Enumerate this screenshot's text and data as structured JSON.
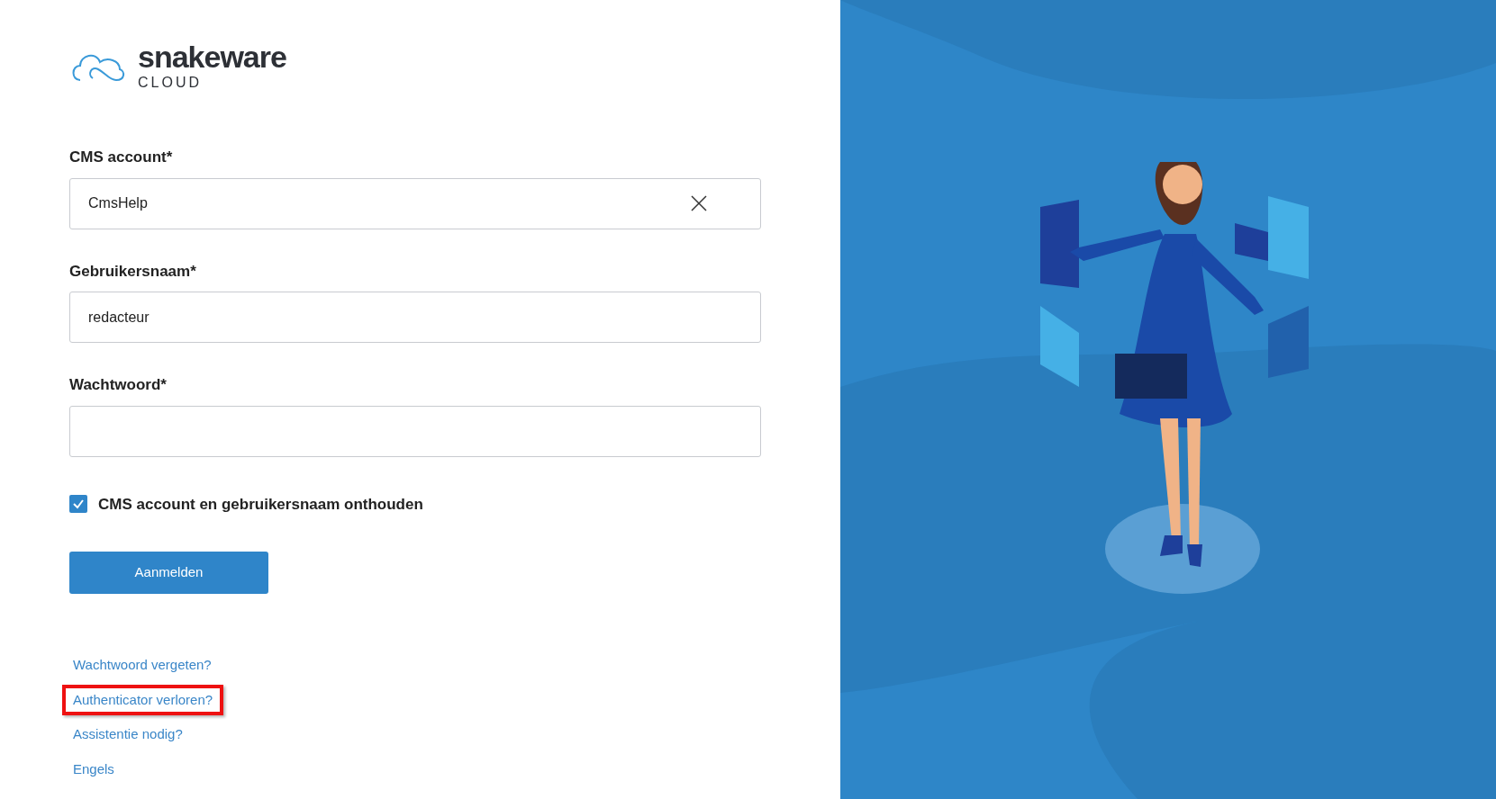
{
  "logo": {
    "brand": "snakeware",
    "sub": "CLOUD"
  },
  "fields": [
    {
      "label": "CMS account*",
      "value": "CmsHelp",
      "clearable": true
    },
    {
      "label": "Gebruikersnaam*",
      "value": "redacteur",
      "clearable": false
    },
    {
      "label": "Wachtwoord*",
      "clearable": false
    }
  ],
  "remember": {
    "label": "CMS account en gebruikersnaam onthouden",
    "checked": true
  },
  "submit": "Aanmelden",
  "links": [
    {
      "label": "Wachtwoord vergeten?",
      "highlighted": false
    },
    {
      "label": "Authenticator verloren?",
      "highlighted": true
    },
    {
      "label": "Assistentie nodig?",
      "highlighted": false
    },
    {
      "label": "Engels",
      "highlighted": false
    }
  ]
}
